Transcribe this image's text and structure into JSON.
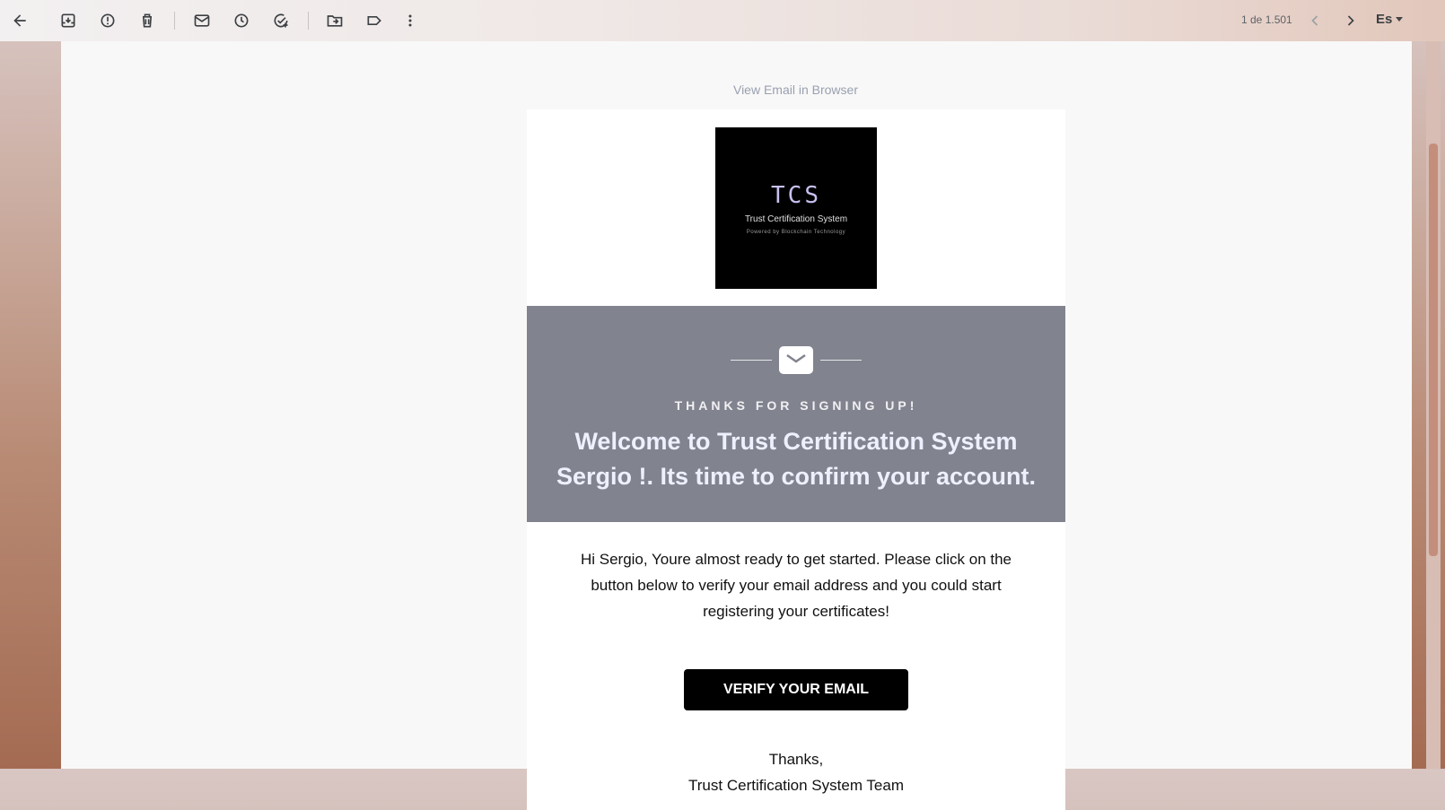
{
  "toolbar": {
    "icons": [
      "back-arrow-icon",
      "archive-icon",
      "report-spam-icon",
      "delete-icon",
      "mark-unread-icon",
      "snooze-icon",
      "add-task-icon",
      "move-to-icon",
      "label-icon",
      "more-icon"
    ]
  },
  "pager": {
    "text": "1 de 1.501"
  },
  "language": {
    "label": "Es"
  },
  "email": {
    "view_in_browser": "View Email in Browser",
    "logo": {
      "title": "TCS",
      "subtitle": "Trust Certification System",
      "tagline": "Powered by Blockchain Technology"
    },
    "banner": {
      "thanks": "THANKS FOR SIGNING UP!",
      "welcome": "Welcome to Trust Certification System Sergio !. Its time to confirm your account."
    },
    "body": "Hi Sergio, Youre almost ready to get started. Please click on the button below to verify your email address and you could start registering your certificates!",
    "verify_button": "VERIFY YOUR EMAIL",
    "sign_off": "Thanks,",
    "team": "Trust Certification System Team"
  },
  "colors": {
    "banner": "#81838e",
    "button": "#000000",
    "link": "#9aa0b0"
  }
}
